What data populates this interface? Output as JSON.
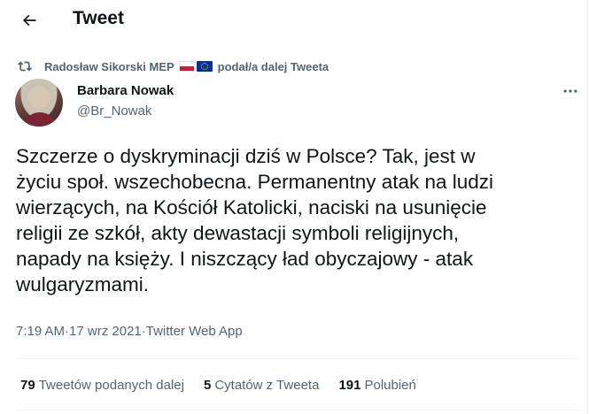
{
  "header": {
    "back_icon": "arrow-left-icon",
    "title": "Tweet"
  },
  "retweet": {
    "icon": "retweet-icon",
    "name": "Radosław Sikorski MEP",
    "flags": [
      "poland-flag",
      "eu-flag"
    ],
    "suffix": "podał/a dalej Tweeta"
  },
  "author": {
    "name": "Barbara Nowak",
    "handle": "@Br_Nowak"
  },
  "tweet": {
    "text": "Szczerze o dyskryminacji dziś w Polsce? Tak, jest w\nżyciu społ. wszechobecna. Permanentny atak na ludzi\nwierzących, na Kościół Katolicki, naciski na usunięcie\nreligii ze szkół, akty dewastacji symboli religijnych,\nnapady na księży. I niszczący ład obyczajowy - atak\nwulgaryzmami.",
    "time": "7:19 AM",
    "dot": " · ",
    "date": "17 wrz 2021",
    "dot2": " · ",
    "source": "Twitter Web App"
  },
  "stats": [
    {
      "count": "79",
      "label": "Tweetów podanych dalej"
    },
    {
      "count": "5",
      "label": "Cytatów z Tweeta"
    },
    {
      "count": "191",
      "label": "Polubień"
    }
  ],
  "colors": {
    "text": "#0f1419",
    "secondary": "#536471",
    "divider": "#eff3f4"
  }
}
